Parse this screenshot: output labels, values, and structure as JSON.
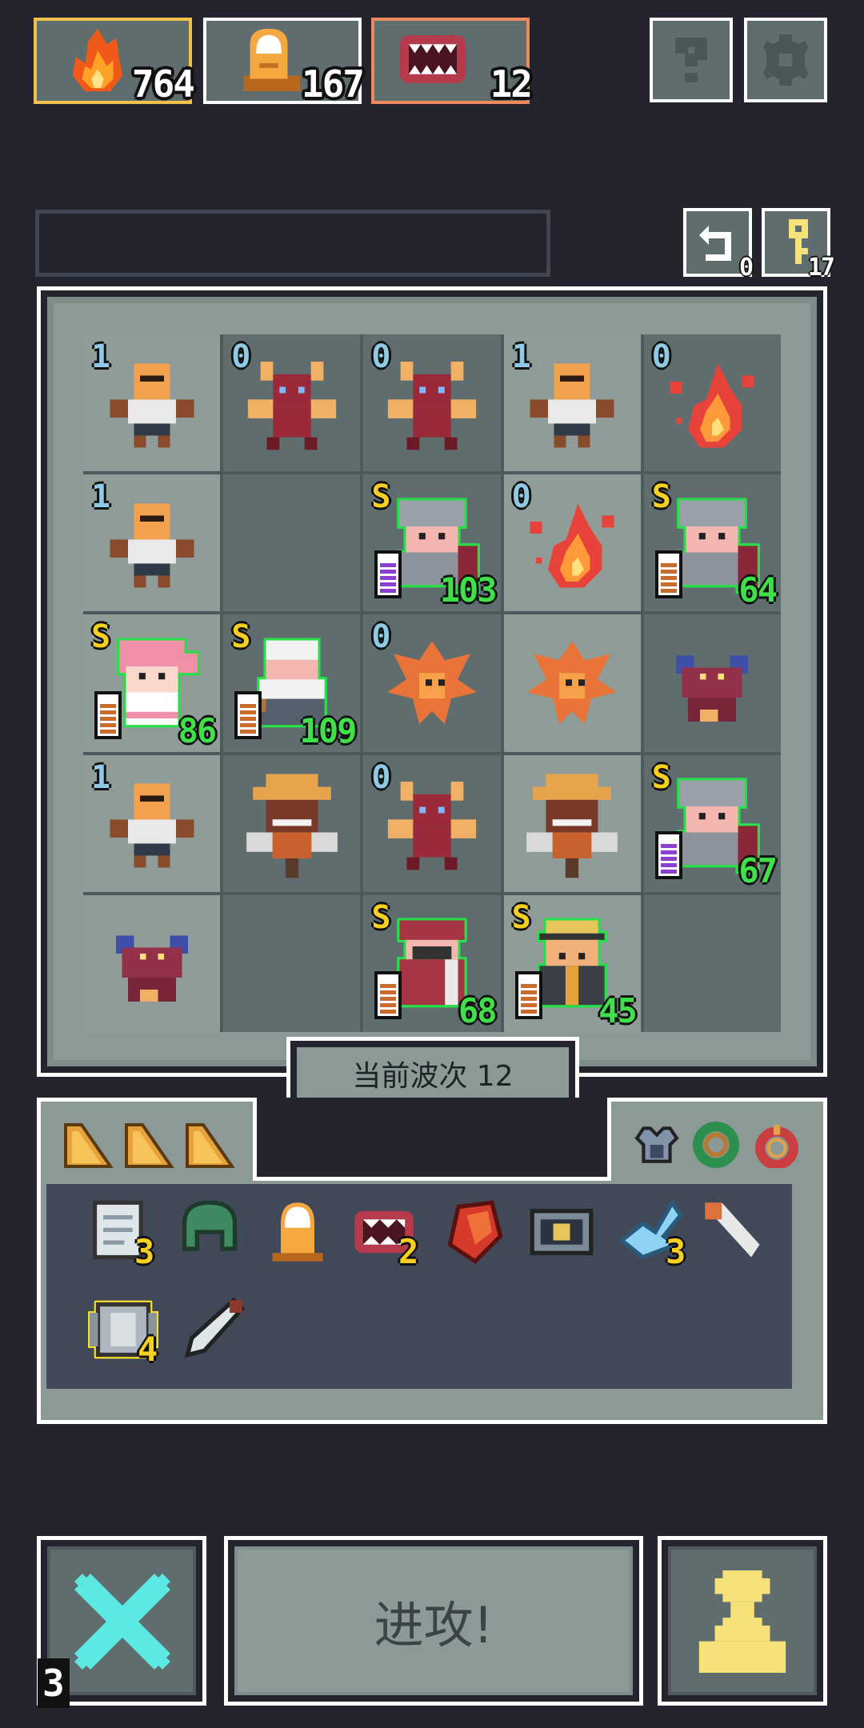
{
  "resources": [
    {
      "name": "fire",
      "count": "764"
    },
    {
      "name": "finger",
      "count": "167"
    },
    {
      "name": "mouth",
      "count": "12"
    }
  ],
  "icons": {
    "help": "question-icon",
    "settings": "gear-icon"
  },
  "undo_count": "0",
  "key_count": "17",
  "grid": [
    {
      "unit": "bald-brute",
      "level": "1",
      "kind": "enemy"
    },
    {
      "unit": "horned-imp",
      "level": "0",
      "kind": "enemy"
    },
    {
      "unit": "horned-imp",
      "level": "0",
      "kind": "enemy"
    },
    {
      "unit": "bald-brute",
      "level": "1",
      "kind": "enemy"
    },
    {
      "unit": "fire-spirit",
      "level": "0",
      "kind": "enemy"
    },
    {
      "unit": "bald-brute",
      "level": "1",
      "kind": "enemy"
    },
    {
      "unit": "empty",
      "level": "",
      "kind": "empty"
    },
    {
      "unit": "helmet-knight",
      "level": "S",
      "kind": "hero",
      "hp": "103",
      "bar": "purple"
    },
    {
      "unit": "fire-spirit",
      "level": "0",
      "kind": "enemy"
    },
    {
      "unit": "helmet-knight",
      "level": "S",
      "kind": "hero",
      "hp": "64",
      "bar": "orange"
    },
    {
      "unit": "pink-girl",
      "level": "S",
      "kind": "hero",
      "hp": "86",
      "bar": "orange"
    },
    {
      "unit": "old-chef",
      "level": "S",
      "kind": "hero",
      "hp": "109",
      "bar": "orange"
    },
    {
      "unit": "flame-bird",
      "level": "0",
      "kind": "enemy"
    },
    {
      "unit": "flame-bird",
      "level": "",
      "kind": "enemy"
    },
    {
      "unit": "red-goblin",
      "level": "",
      "kind": "enemy"
    },
    {
      "unit": "bald-brute",
      "level": "1",
      "kind": "enemy"
    },
    {
      "unit": "scarecrow",
      "level": "",
      "kind": "enemy"
    },
    {
      "unit": "horned-imp",
      "level": "0",
      "kind": "enemy"
    },
    {
      "unit": "scarecrow",
      "level": "",
      "kind": "enemy"
    },
    {
      "unit": "helmet-knight",
      "level": "S",
      "kind": "hero",
      "hp": "67",
      "bar": "purple"
    },
    {
      "unit": "red-goblin",
      "level": "",
      "kind": "enemy"
    },
    {
      "unit": "empty",
      "level": "",
      "kind": "empty"
    },
    {
      "unit": "red-mage",
      "level": "S",
      "kind": "hero",
      "hp": "68",
      "bar": "orange"
    },
    {
      "unit": "capped-guard",
      "level": "S",
      "kind": "hero",
      "hp": "45",
      "bar": "orange"
    },
    {
      "unit": "empty",
      "level": "",
      "kind": "empty"
    }
  ],
  "wave_label": "当前波次 12",
  "cheese_tabs": 3,
  "relic_icons": [
    "armor-icon",
    "green-ring-icon",
    "red-ring-icon"
  ],
  "inventory": [
    {
      "name": "scroll",
      "count": "3"
    },
    {
      "name": "green-helmet",
      "count": ""
    },
    {
      "name": "finger",
      "count": ""
    },
    {
      "name": "mouth",
      "count": "2"
    },
    {
      "name": "red-gem",
      "count": ""
    },
    {
      "name": "chest",
      "count": ""
    },
    {
      "name": "ice-shard",
      "count": "3"
    },
    {
      "name": "tooth-dagger",
      "count": ""
    },
    {
      "name": "steel-plate",
      "count": "4"
    },
    {
      "name": "blade",
      "count": ""
    }
  ],
  "bottom": {
    "cancel_count": "3",
    "attack_label": "进攻!"
  },
  "colors": {
    "hp_green": "#3fe04a",
    "level_yellow": "#f5d021",
    "level_blue": "#8fc9e3",
    "accent_cyan": "#5ce9e4",
    "pawn_yellow": "#f7e27a"
  }
}
